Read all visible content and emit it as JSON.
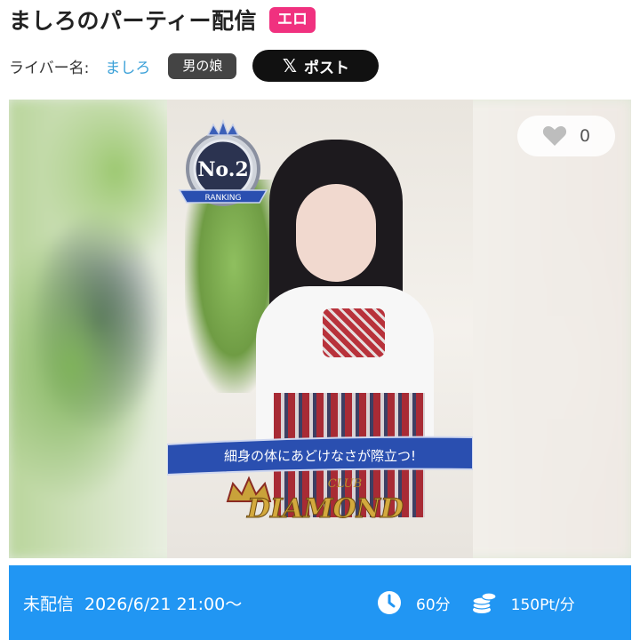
{
  "header": {
    "title": "ましろのパーティー配信",
    "category_badge": "エロ"
  },
  "liver": {
    "label": "ライバー名:",
    "name": "ましろ",
    "tag": "男の娘",
    "post_button": "ポスト"
  },
  "media": {
    "emblem_text": "No.2",
    "emblem_ribbon": "RANKING",
    "banner_text": "細身の体にあどけなさが際立つ!",
    "logo_top": "CLUB",
    "logo_main": "DIAMOND",
    "likes": "0"
  },
  "info": {
    "status": "未配信",
    "datetime": "2026/6/21 21:00〜",
    "duration": "60分",
    "price": "150Pt/分"
  },
  "colors": {
    "badge_pink": "#f0317f",
    "liver_link": "#3aa0d8",
    "info_bar": "#2196f3"
  },
  "icons": [
    "x-logo-icon",
    "heart-icon",
    "clock-icon",
    "coins-icon",
    "crown-icon"
  ]
}
